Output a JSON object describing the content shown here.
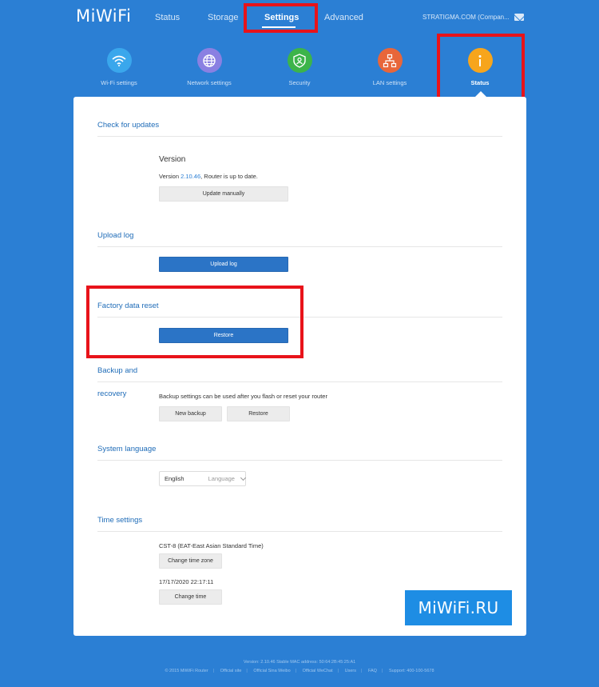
{
  "header": {
    "logo": "MiWiFi",
    "nav": [
      "Status",
      "Storage",
      "Settings",
      "Advanced"
    ],
    "account": "STRATIGMA.COM (Compan..."
  },
  "categories": [
    {
      "label": "Wi-Fi settings",
      "color": "#3aa7ec",
      "icon": "wifi-icon"
    },
    {
      "label": "Network settings",
      "color": "#8a80e2",
      "icon": "globe-icon"
    },
    {
      "label": "Security",
      "color": "#3cb44a",
      "icon": "shield-icon"
    },
    {
      "label": "LAN settings",
      "color": "#e8663a",
      "icon": "network-icon"
    },
    {
      "label": "Status",
      "color": "#f7a51c",
      "icon": "info-icon"
    }
  ],
  "updates": {
    "title": "Check for updates",
    "version_heading": "Version",
    "version_prefix": "Version ",
    "version_number": "2.10.46",
    "version_suffix": ", Router is up to date.",
    "button": "Update manually"
  },
  "upload_log": {
    "title": "Upload log",
    "button": "Upload log"
  },
  "factory_reset": {
    "title": "Factory data reset",
    "button": "Restore"
  },
  "backup": {
    "title_line1": "Backup and",
    "title_line2": "recovery",
    "description": "Backup settings can be used after you flash or reset your router",
    "new_backup": "New backup",
    "restore": "Restore"
  },
  "language": {
    "title": "System language",
    "value": "English",
    "placeholder": "Language"
  },
  "time": {
    "title": "Time settings",
    "timezone": "CST-8 (EAT-East Asian Standard Time)",
    "change_timezone": "Change time zone",
    "datetime": "17/17/2020 22:17:11",
    "change_time": "Change time"
  },
  "watermark": "MiWiFi.RU",
  "footer": {
    "version_line": "Version: 2.10.46 Stable  MAC address: 50:64:2B:45:25:A1",
    "links": [
      "© 2015 MiWiFi Router",
      "Official site",
      "Official Sina Weibo",
      "Official WeChat",
      "Users",
      "FAQ",
      "Support: 400-100-5678"
    ]
  },
  "colors": {
    "background": "#2b7fd4",
    "highlight": "#e8131a",
    "primary_button": "#2b74c6"
  }
}
